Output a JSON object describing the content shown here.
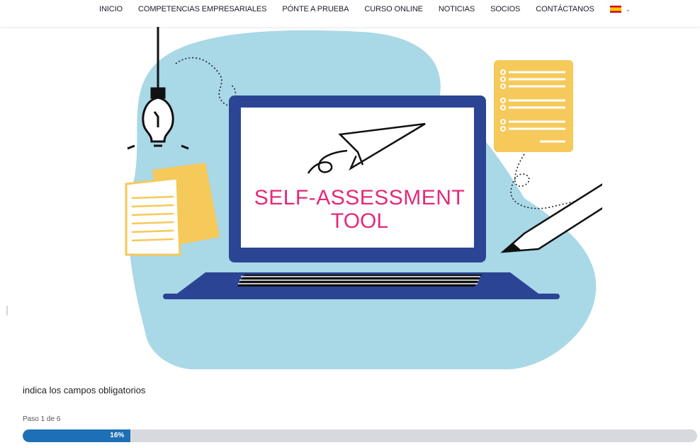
{
  "nav": {
    "items": [
      {
        "label": "INICIO"
      },
      {
        "label": "COMPETENCIAS EMPRESARIALES"
      },
      {
        "label": "PÓNTE A PRUEBA"
      },
      {
        "label": "CURSO ONLINE"
      },
      {
        "label": "NOTICIAS"
      },
      {
        "label": "SOCIOS"
      },
      {
        "label": "CONTÁCTANOS"
      }
    ],
    "language": {
      "flag_icon": "spain-flag-icon",
      "chevron_icon": "chevron-down-icon"
    }
  },
  "hero": {
    "title_line1": "SELF-ASSESSMENT",
    "title_line2": "TOOL",
    "colors": {
      "blob": "#a9d8e7",
      "laptop": "#2b4594",
      "paper": "#f5c95a",
      "title": "#e32a7a"
    }
  },
  "form": {
    "required_note": "indica los campos obligatorios",
    "step_label": "Paso 1 de 6",
    "progress": {
      "percent": 16,
      "label": "16%"
    }
  }
}
